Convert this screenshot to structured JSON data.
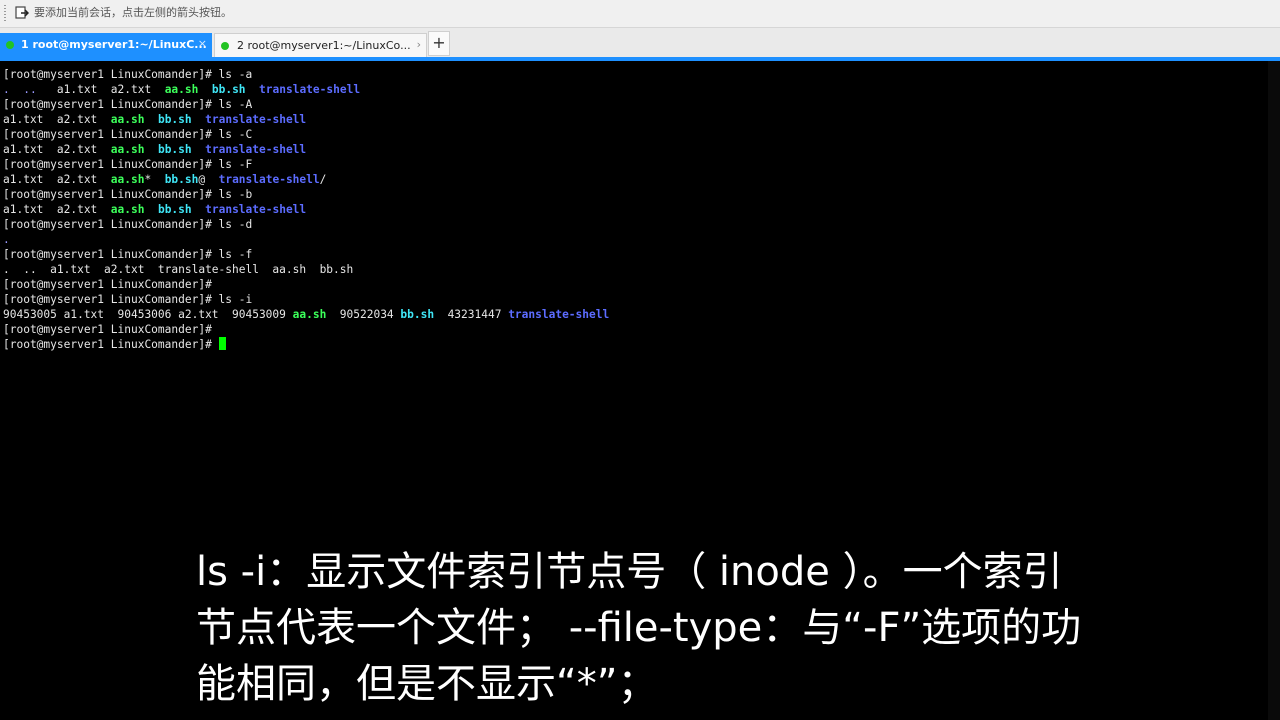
{
  "hint": {
    "icon": "add-session-icon",
    "text": "要添加当前会话，点击左侧的箭头按钮。"
  },
  "tabs": [
    {
      "label": "1 root@myserver1:~/LinuxC...",
      "status": "connected",
      "close": "×",
      "active": true
    },
    {
      "label": "2 root@myserver1:~/LinuxCo...",
      "status": "connected",
      "close": "›",
      "active": false
    }
  ],
  "new_tab": "+",
  "terminal": {
    "colors": {
      "executable": "#3cff5a",
      "link": "#3fe5f5",
      "directory": "#5c6cff",
      "cursor": "#00ff00"
    },
    "prompt": "[root@myserver1 LinuxComander]# ",
    "lines": [
      [
        {
          "t": "[root@myserver1 LinuxComander]# ls -a"
        }
      ],
      [
        {
          "t": ". ",
          "c": "dim"
        },
        {
          "t": " .. ",
          "c": "dim"
        },
        {
          "t": "  a1.txt  a2.txt  "
        },
        {
          "t": "aa.sh",
          "c": "green"
        },
        {
          "t": "  "
        },
        {
          "t": "bb.sh",
          "c": "cyan"
        },
        {
          "t": "  "
        },
        {
          "t": "translate-shell",
          "c": "blue"
        }
      ],
      [
        {
          "t": "[root@myserver1 LinuxComander]# ls -A"
        }
      ],
      [
        {
          "t": "a1.txt  a2.txt  "
        },
        {
          "t": "aa.sh",
          "c": "green"
        },
        {
          "t": "  "
        },
        {
          "t": "bb.sh",
          "c": "cyan"
        },
        {
          "t": "  "
        },
        {
          "t": "translate-shell",
          "c": "blue"
        }
      ],
      [
        {
          "t": "[root@myserver1 LinuxComander]# ls -C"
        }
      ],
      [
        {
          "t": "a1.txt  a2.txt  "
        },
        {
          "t": "aa.sh",
          "c": "green"
        },
        {
          "t": "  "
        },
        {
          "t": "bb.sh",
          "c": "cyan"
        },
        {
          "t": "  "
        },
        {
          "t": "translate-shell",
          "c": "blue"
        }
      ],
      [
        {
          "t": "[root@myserver1 LinuxComander]# ls -F"
        }
      ],
      [
        {
          "t": "a1.txt  a2.txt  "
        },
        {
          "t": "aa.sh",
          "c": "green"
        },
        {
          "t": "*  "
        },
        {
          "t": "bb.sh",
          "c": "cyan"
        },
        {
          "t": "@  "
        },
        {
          "t": "translate-shell",
          "c": "blue"
        },
        {
          "t": "/"
        }
      ],
      [
        {
          "t": "[root@myserver1 LinuxComander]# ls -b"
        }
      ],
      [
        {
          "t": "a1.txt  a2.txt  "
        },
        {
          "t": "aa.sh",
          "c": "green"
        },
        {
          "t": "  "
        },
        {
          "t": "bb.sh",
          "c": "cyan"
        },
        {
          "t": "  "
        },
        {
          "t": "translate-shell",
          "c": "blue"
        }
      ],
      [
        {
          "t": "[root@myserver1 LinuxComander]# ls -d"
        }
      ],
      [
        {
          "t": ".",
          "c": "dim"
        }
      ],
      [
        {
          "t": "[root@myserver1 LinuxComander]# ls -f"
        }
      ],
      [
        {
          "t": ".  ..  a1.txt  a2.txt  translate-shell  aa.sh  bb.sh"
        }
      ],
      [
        {
          "t": "[root@myserver1 LinuxComander]#"
        }
      ],
      [
        {
          "t": "[root@myserver1 LinuxComander]# ls -i"
        }
      ],
      [
        {
          "t": "90453005 a1.txt  90453006 a2.txt  90453009 "
        },
        {
          "t": "aa.sh",
          "c": "green"
        },
        {
          "t": "  90522034 "
        },
        {
          "t": "bb.sh",
          "c": "cyan"
        },
        {
          "t": "  43231447 "
        },
        {
          "t": "translate-shell",
          "c": "blue"
        }
      ],
      [
        {
          "t": "[root@myserver1 LinuxComander]#"
        }
      ],
      [
        {
          "t": "[root@myserver1 LinuxComander]# "
        },
        {
          "cursor": true
        }
      ]
    ]
  },
  "subtitle": {
    "lines": [
      "ls -i：显示文件索引节点号（ inode ）。一个索引",
      "节点代表一个文件； --file-type：与“-F”选项的功",
      "能相同，但是不显示“*”；"
    ]
  }
}
